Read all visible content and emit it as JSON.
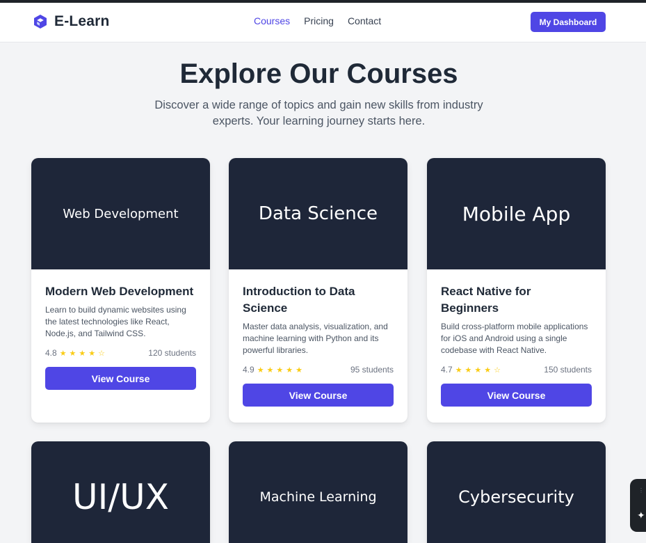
{
  "brand": {
    "name": "E-Learn",
    "icon": "cube-icon",
    "accent": "#4f46e5"
  },
  "nav": {
    "links": [
      "Courses",
      "Pricing",
      "Contact"
    ],
    "active": "Courses",
    "dashboard_label": "My Dashboard"
  },
  "hero": {
    "title": "Explore Our Courses",
    "subtitle": "Discover a wide range of topics and gain new skills from industry experts. Your learning journey starts here."
  },
  "courses": [
    {
      "banner": "Web Development",
      "title": "Modern Web Development",
      "description": "Learn to build dynamic websites using the latest technologies like React, Node.js, and Tailwind CSS.",
      "rating": "4.8",
      "stars": "★★★★☆",
      "students": "120 students",
      "button": "View Course"
    },
    {
      "banner": "Data Science",
      "title": "Introduction to Data Science",
      "description": "Master data analysis, visualization, and machine learning with Python and its powerful libraries.",
      "rating": "4.9",
      "stars": "★★★★★",
      "students": "95 students",
      "button": "View Course"
    },
    {
      "banner": "Mobile App",
      "title": "React Native for Beginners",
      "description": "Build cross-platform mobile applications for iOS and Android using a single codebase with React Native.",
      "rating": "4.7",
      "stars": "★★★★☆",
      "students": "150 students",
      "button": "View Course"
    },
    {
      "banner": "UI/UX"
    },
    {
      "banner": "Machine Learning"
    },
    {
      "banner": "Cybersecurity"
    }
  ],
  "colors": {
    "banner_bg": "#1e2639",
    "page_bg": "#f3f4f6",
    "star": "#facc15"
  }
}
